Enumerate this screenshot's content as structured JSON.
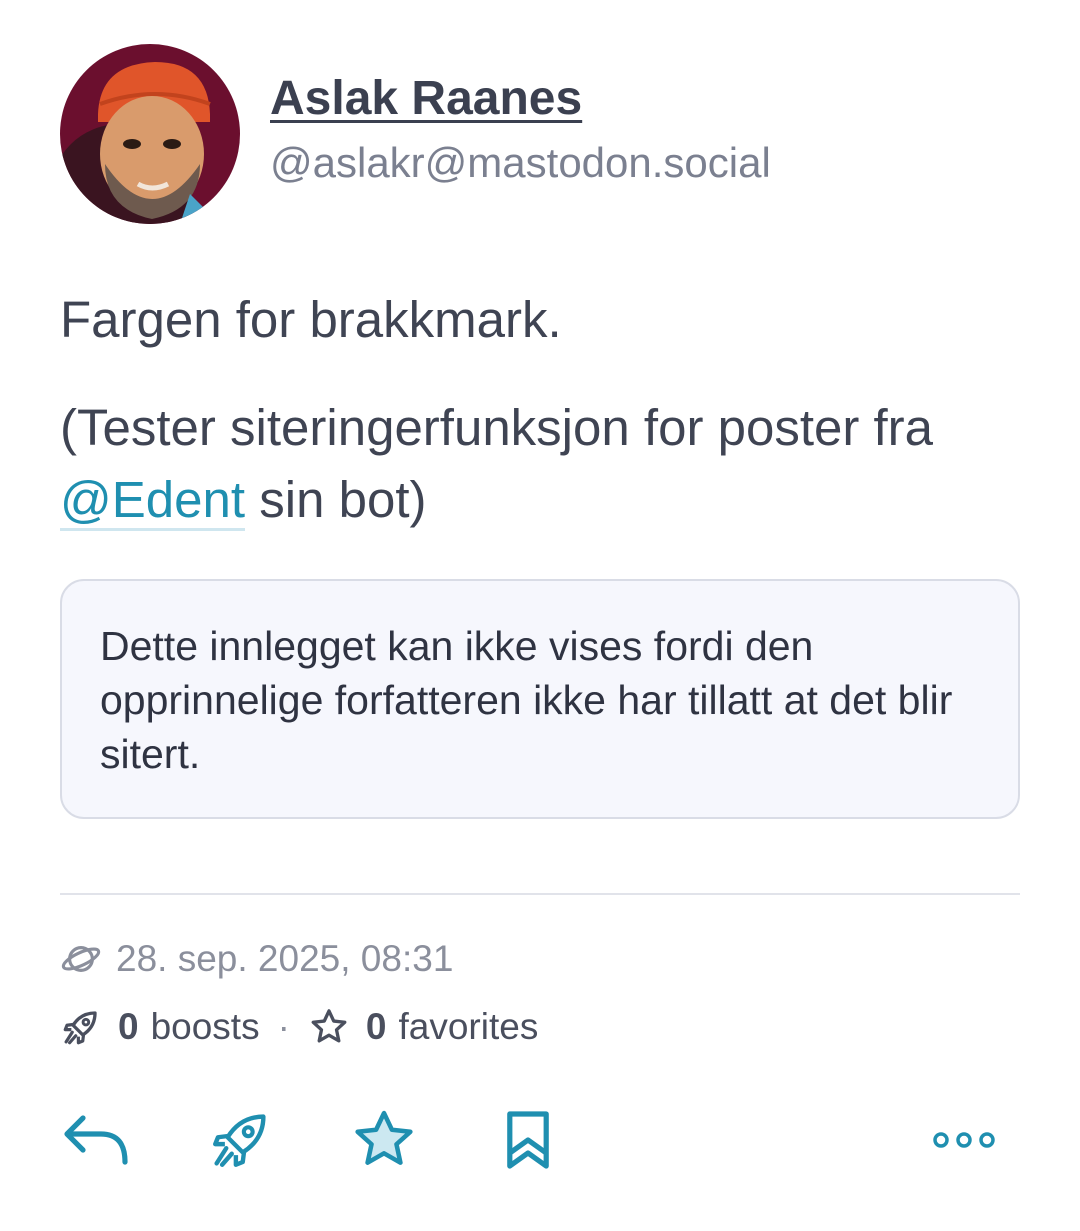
{
  "author": {
    "display_name": "Aslak Raanes",
    "handle": "@aslakr@mastodon.social"
  },
  "post": {
    "paragraph1": "Fargen for brakkmark.",
    "paragraph2_before": "(Tester siteringerfunksjon for poster fra ",
    "mention": "@Edent",
    "paragraph2_after": " sin bot)"
  },
  "quote": {
    "text": "Dette innlegget kan ikke vises fordi den opprinnelige forfatteren ikke har tillatt at det blir sitert."
  },
  "meta": {
    "visibility_icon": "globe-icon",
    "date": "28. sep. 2025, 08:31"
  },
  "stats": {
    "boosts_count": "0",
    "boosts_label": "boosts",
    "separator": "·",
    "favorites_count": "0",
    "favorites_label": "favorites"
  },
  "actions": {
    "icons": [
      "reply-icon",
      "boost-icon",
      "favorite-icon",
      "bookmark-icon",
      "more-icon"
    ]
  },
  "colors": {
    "accent": "#1f8fb0",
    "text": "#3f4453",
    "muted": "#8b8f9c",
    "quote_bg": "#f6f7fd",
    "quote_border": "#d9dce6"
  }
}
